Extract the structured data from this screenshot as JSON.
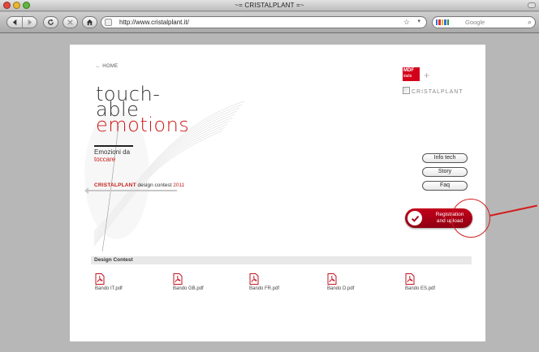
{
  "window": {
    "title": "~= CRISTALPLANT =~"
  },
  "toolbar": {
    "url": "http://www.cristalplant.it/",
    "search_placeholder": "Google"
  },
  "page": {
    "home_link": "← HOME",
    "headline": {
      "line1": "touch-",
      "line2": "able",
      "line3": "emotions"
    },
    "subtitle": {
      "line1": "Emozioni da",
      "line2": "toccare"
    },
    "contest": {
      "brand": "CRISTALPLANT",
      "middle": " design contest ",
      "year": "2011"
    },
    "logos": {
      "mdf": "MDF",
      "mdf_sub": "italia",
      "plus": "+",
      "cristalplant": "CRISTALPLANT"
    },
    "nav": [
      {
        "label": "Info tech"
      },
      {
        "label": "Story"
      },
      {
        "label": "Faq"
      }
    ],
    "registration": {
      "line1": "Registration",
      "line2": "and upload"
    },
    "section_title": "Design Contest",
    "pdfs": [
      {
        "label": "Bando IT.pdf"
      },
      {
        "label": "Bando GB.pdf"
      },
      {
        "label": "Bando FR.pdf"
      },
      {
        "label": "Bando D.pdf"
      },
      {
        "label": "Bando ES.pdf"
      }
    ]
  },
  "colors": {
    "accent": "#d01a1a",
    "button_red": "#a8001a",
    "page_bg": "#b7b7b7"
  }
}
